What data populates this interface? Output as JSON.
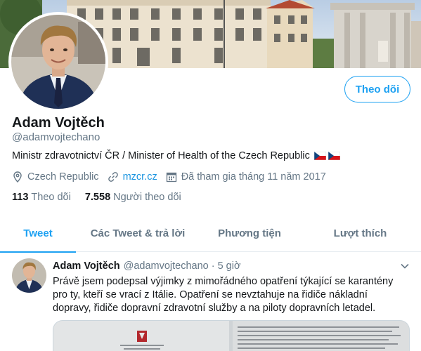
{
  "profile": {
    "display_name": "Adam Vojtěch",
    "handle": "@adamvojtechano",
    "bio": "Ministr zdravotnictví ČR / Minister of Health of the Czech Republic",
    "location": "Czech Republic",
    "website": "mzcr.cz",
    "joined": "Đã tham gia tháng 11 năm 2017",
    "following_count": "113",
    "following_label": "Theo dõi",
    "followers_count": "7.558",
    "followers_label": "Người theo dõi",
    "follow_button": "Theo dõi",
    "bio_flags": [
      "czech-flag",
      "czech-flag"
    ]
  },
  "tabs": [
    {
      "label": "Tweet",
      "active": true
    },
    {
      "label": "Các Tweet & trả lời",
      "active": false
    },
    {
      "label": "Phương tiện",
      "active": false
    },
    {
      "label": "Lượt thích",
      "active": false
    }
  ],
  "tweet": {
    "name": "Adam Vojtěch",
    "handle": "@adamvojtechano",
    "separator": "·",
    "time": "5 giờ",
    "text": "Právě jsem podepsal výjimky z mimořádného opatření týkající se karantény pro ty, kteří se vrací z Itálie. Opatření se nevztahuje na řidiče nákladní dopravy, řidiče dopravní zdravotní služby a na piloty dopravních letadel."
  },
  "icons": {
    "location": "location-pin-icon",
    "link": "link-icon",
    "calendar": "calendar-icon",
    "caret": "chevron-down-icon"
  },
  "colors": {
    "accent": "#1da1f2",
    "link": "#1b95e0",
    "muted": "#657786",
    "text": "#14171a",
    "divider": "#e6ecf0"
  }
}
